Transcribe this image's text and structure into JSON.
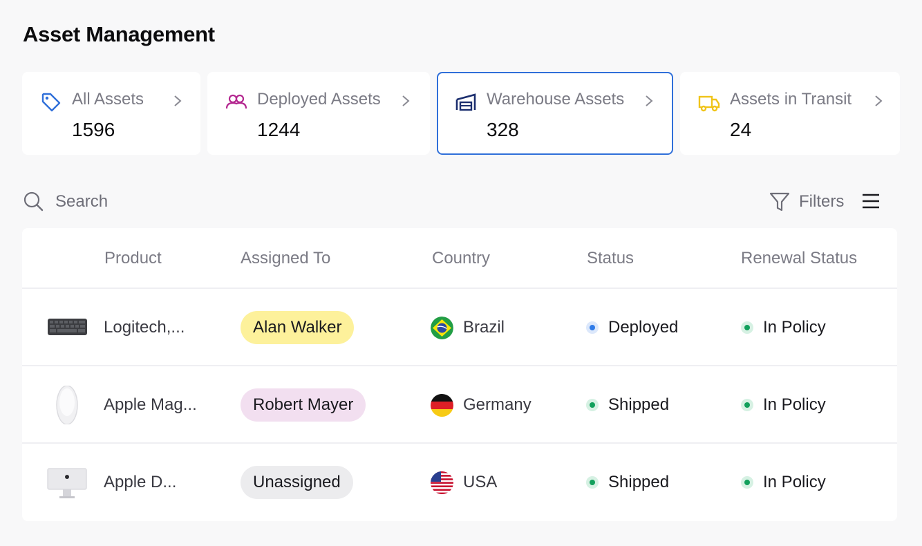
{
  "title": "Asset Management",
  "cards": [
    {
      "label": "All Assets",
      "value": "1596",
      "icon": "tag-icon",
      "icon_color": "#2f6fd9"
    },
    {
      "label": "Deployed Assets",
      "value": "1244",
      "icon": "users-icon",
      "icon_color": "#b3268f"
    },
    {
      "label": "Warehouse Assets",
      "value": "328",
      "icon": "warehouse-icon",
      "icon_color": "#1b2e6e"
    },
    {
      "label": "Assets in Transit",
      "value": "24",
      "icon": "truck-icon",
      "icon_color": "#f0c419"
    }
  ],
  "active_card": "Warehouse Assets",
  "search": {
    "placeholder": "Search"
  },
  "filters_label": "Filters",
  "table": {
    "headers": {
      "product": "Product",
      "assigned_to": "Assigned To",
      "country": "Country",
      "status": "Status",
      "renewal_status": "Renewal Status"
    },
    "rows": [
      {
        "product": "Logitech,...",
        "product_image": "keyboard",
        "assigned_to": "Alan Walker",
        "assigned_color": "#fdf19b",
        "country": "Brazil",
        "flag": "brazil-flag",
        "status": "Deployed",
        "status_color": "#2f7be8",
        "renewal_status": "In Policy",
        "renewal_color": "#12a05c"
      },
      {
        "product": "Apple Mag...",
        "product_image": "magic-mouse",
        "assigned_to": "Robert Mayer",
        "assigned_color": "#f2dff0",
        "country": "Germany",
        "flag": "germany-flag",
        "status": "Shipped",
        "status_color": "#12a05c",
        "renewal_status": "In Policy",
        "renewal_color": "#12a05c"
      },
      {
        "product": "Apple D...",
        "product_image": "studio-display",
        "assigned_to": "Unassigned",
        "assigned_color": "#ececee",
        "country": "USA",
        "flag": "usa-flag",
        "status": "Shipped",
        "status_color": "#12a05c",
        "renewal_status": "In Policy",
        "renewal_color": "#12a05c"
      }
    ]
  }
}
